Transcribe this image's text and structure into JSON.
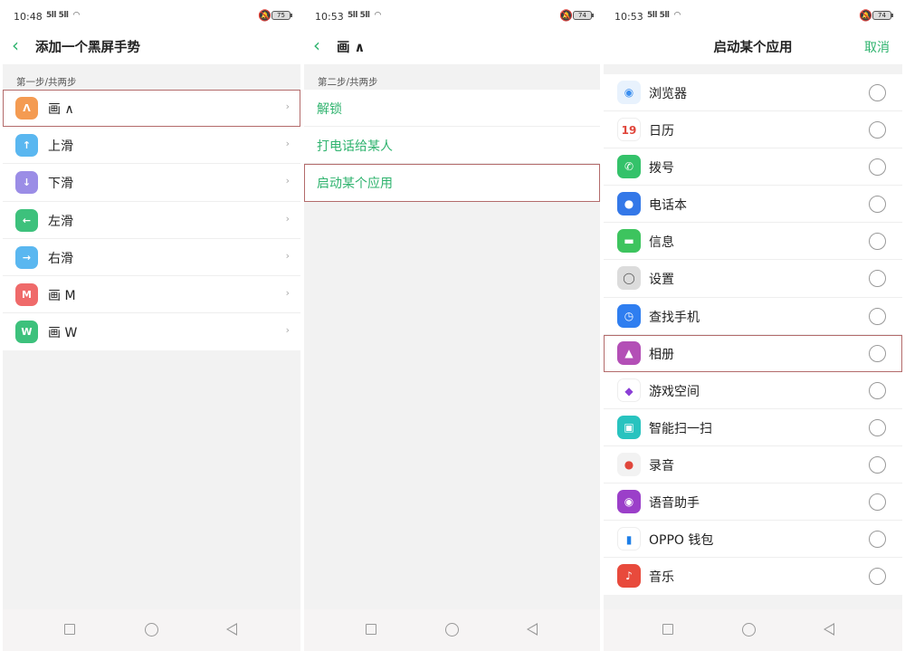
{
  "screen1": {
    "status": {
      "time": "10:48",
      "signal": "5ll 5ll",
      "battery": "75"
    },
    "title": "添加一个黑屏手势",
    "section": "第一步/共两步",
    "items": [
      {
        "label": "画 ∧",
        "glyph": "Λ",
        "color": "#f49b52"
      },
      {
        "label": "上滑",
        "glyph": "↑",
        "color": "#5ab7f0"
      },
      {
        "label": "下滑",
        "glyph": "↓",
        "color": "#9b8de6"
      },
      {
        "label": "左滑",
        "glyph": "←",
        "color": "#3dc17c"
      },
      {
        "label": "右滑",
        "glyph": "→",
        "color": "#5ab7f0"
      },
      {
        "label": "画 M",
        "glyph": "M",
        "color": "#ef6a6a"
      },
      {
        "label": "画 W",
        "glyph": "W",
        "color": "#3dc17c"
      }
    ],
    "chevron": "›"
  },
  "screen2": {
    "status": {
      "time": "10:53",
      "signal": "5ll 5ll",
      "battery": "74"
    },
    "title": "画 ∧",
    "section": "第二步/共两步",
    "items": [
      {
        "label": "解锁"
      },
      {
        "label": "打电话给某人"
      },
      {
        "label": "启动某个应用"
      }
    ]
  },
  "screen3": {
    "status": {
      "time": "10:53",
      "signal": "5ll 5ll",
      "battery": "74"
    },
    "title": "启动某个应用",
    "cancel": "取消",
    "apps": [
      {
        "label": "浏览器",
        "icon": "browser-icon",
        "glyph": "◉",
        "color": "#3b8ff0",
        "bg": "#e8f2fd"
      },
      {
        "label": "日历",
        "icon": "calendar-icon",
        "glyph": "19",
        "color": "#e0463b",
        "bg": "#ffffff"
      },
      {
        "label": "拨号",
        "icon": "phone-icon",
        "glyph": "✆",
        "color": "#ffffff",
        "bg": "#34c26a"
      },
      {
        "label": "电话本",
        "icon": "contacts-icon",
        "glyph": "●",
        "color": "#ffffff",
        "bg": "#3478e8"
      },
      {
        "label": "信息",
        "icon": "message-icon",
        "glyph": "▬",
        "color": "#ffffff",
        "bg": "#3dc45e"
      },
      {
        "label": "设置",
        "icon": "settings-icon",
        "glyph": "◯",
        "color": "#555555",
        "bg": "#dcdcdc"
      },
      {
        "label": "查找手机",
        "icon": "find-phone-icon",
        "glyph": "◷",
        "color": "#ffffff",
        "bg": "#2f7ef0"
      },
      {
        "label": "相册",
        "icon": "photos-icon",
        "glyph": "▲",
        "color": "#ffffff",
        "bg": "#b34fb6"
      },
      {
        "label": "游戏空间",
        "icon": "game-space-icon",
        "glyph": "◆",
        "color": "#8b3fd6",
        "bg": "#ffffff"
      },
      {
        "label": "智能扫一扫",
        "icon": "scan-icon",
        "glyph": "▣",
        "color": "#ffffff",
        "bg": "#28c3bf"
      },
      {
        "label": "录音",
        "icon": "recorder-icon",
        "glyph": "●",
        "color": "#e0463b",
        "bg": "#f2f2f2"
      },
      {
        "label": "语音助手",
        "icon": "voice-assistant-icon",
        "glyph": "◉",
        "color": "#ffffff",
        "bg": "#9b3fc9"
      },
      {
        "label": "OPPO 钱包",
        "icon": "wallet-icon",
        "glyph": "▮",
        "color": "#1e7fe8",
        "bg": "#ffffff"
      },
      {
        "label": "音乐",
        "icon": "music-icon",
        "glyph": "♪",
        "color": "#ffffff",
        "bg": "#e84a3c"
      }
    ]
  }
}
